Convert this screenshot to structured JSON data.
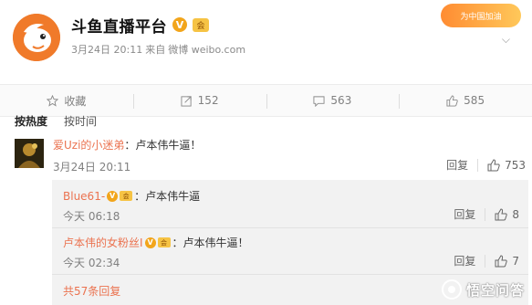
{
  "post": {
    "account_name": "斗鱼直播平台",
    "verified_mark": "V",
    "member_mark": "会",
    "date": "3月24日 20:11",
    "source_prefix": "来自",
    "source": "微博 weibo.com",
    "campaign_badge": "为中国加油"
  },
  "actions": {
    "favorite_label": "收藏",
    "repost_count": "152",
    "comment_count": "563",
    "like_count": "585"
  },
  "sort": {
    "by_hot": "按热度",
    "by_time": "按时间"
  },
  "comment": {
    "user": "爱Uzi的小迷弟",
    "text": "：卢本伟牛逼！",
    "time": "3月24日 20:11",
    "reply_label": "回复",
    "likes": "753"
  },
  "replies": [
    {
      "user": "Blue61-",
      "text": "：卢本伟牛逼",
      "time": "今天 06:18",
      "reply_label": "回复",
      "likes": "8"
    },
    {
      "user": "卢本伟的女粉丝I",
      "text": "：卢本伟牛逼！",
      "time": "今天 02:34",
      "reply_label": "回复",
      "likes": "7"
    }
  ],
  "total_replies": "共57条回复",
  "watermark": "悟空问答",
  "colors": {
    "username": "#eb7350",
    "reply_background": "#f2f2f2",
    "brand_orange": "#f07a2a"
  }
}
